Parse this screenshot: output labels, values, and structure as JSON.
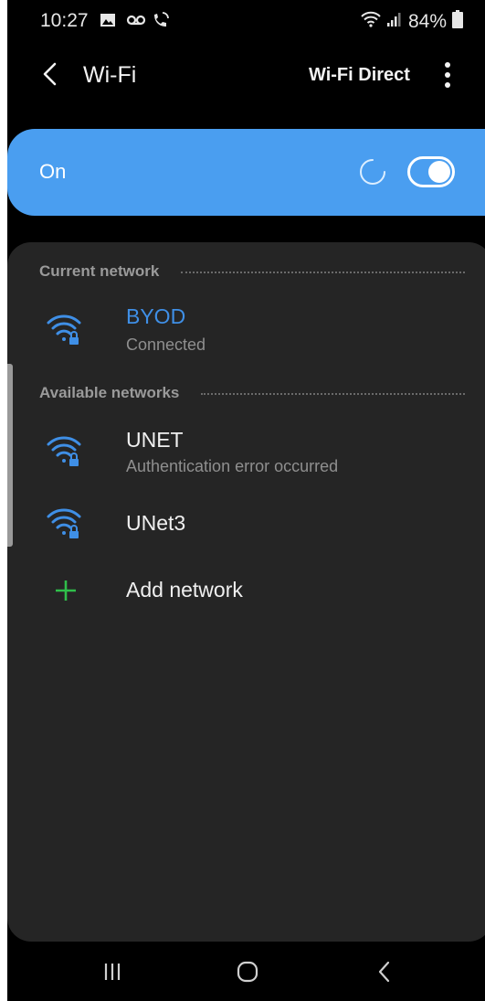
{
  "status_bar": {
    "time": "10:27",
    "battery": "84%",
    "icons": [
      "gallery-icon",
      "voicemail-icon",
      "wifi-call-icon",
      "wifi-signal-icon",
      "cell-signal-icon",
      "battery-icon"
    ]
  },
  "app_bar": {
    "title": "Wi-Fi",
    "action_label": "Wi-Fi Direct",
    "icons": [
      "back-arrow-icon",
      "more-options-icon"
    ]
  },
  "master_switch": {
    "label": "On",
    "state": true,
    "accent_color": "#4a9ef0"
  },
  "current_network": {
    "header": "Current network",
    "items": [
      {
        "name": "BYOD",
        "status": "Connected",
        "icon": "wifi-locked-icon",
        "color": "#3f8fe6"
      }
    ]
  },
  "available_networks": {
    "header": "Available networks",
    "items": [
      {
        "name": "UNET",
        "status": "Authentication error occurred",
        "icon": "wifi-locked-icon"
      },
      {
        "name": "UNet3",
        "status": "",
        "icon": "wifi-locked-icon"
      }
    ]
  },
  "add_network": {
    "label": "Add network",
    "icon": "plus-icon",
    "color": "#2fbf4a"
  },
  "nav_bar": {
    "icons": [
      "recents-icon",
      "home-icon",
      "back-icon"
    ]
  }
}
